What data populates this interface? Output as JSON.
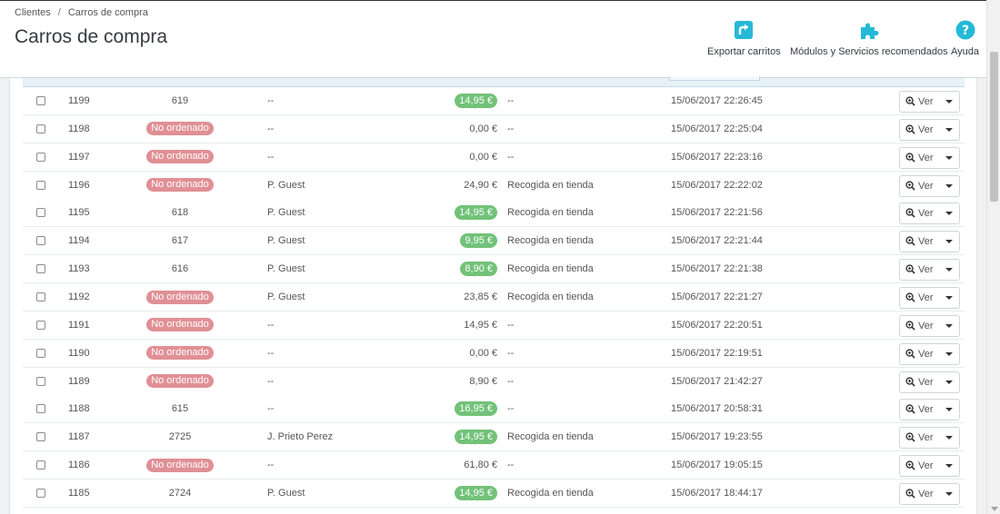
{
  "breadcrumb": {
    "parent": "Clientes",
    "separator": "/",
    "current": "Carros de compra"
  },
  "page_title": "Carros de compra",
  "toolbar": {
    "export_label": "Exportar carritos",
    "modules_label": "Módulos y Servicios recomendados",
    "help_label": "Ayuda"
  },
  "colors": {
    "accent": "#25b9d7",
    "badge_green": "#72c279",
    "badge_red": "#e08f95",
    "filter_row": "#e7f1f8"
  },
  "view_button_label": "Ver",
  "rows": [
    {
      "id": "1199",
      "order": "619",
      "order_status": "ordered",
      "customer": "--",
      "total": "14,95 €",
      "total_highlight": true,
      "carrier": "--",
      "date": "15/06/2017 22:26:45"
    },
    {
      "id": "1198",
      "order": "No ordenado",
      "order_status": "not_ordered",
      "customer": "--",
      "total": "0,00 €",
      "total_highlight": false,
      "carrier": "--",
      "date": "15/06/2017 22:25:04"
    },
    {
      "id": "1197",
      "order": "No ordenado",
      "order_status": "not_ordered",
      "customer": "--",
      "total": "0,00 €",
      "total_highlight": false,
      "carrier": "--",
      "date": "15/06/2017 22:23:16"
    },
    {
      "id": "1196",
      "order": "No ordenado",
      "order_status": "not_ordered",
      "customer": "P. Guest",
      "total": "24,90 €",
      "total_highlight": false,
      "carrier": "Recogida en tienda",
      "date": "15/06/2017 22:22:02"
    },
    {
      "id": "1195",
      "order": "618",
      "order_status": "ordered",
      "customer": "P. Guest",
      "total": "14,95 €",
      "total_highlight": true,
      "carrier": "Recogida en tienda",
      "date": "15/06/2017 22:21:56"
    },
    {
      "id": "1194",
      "order": "617",
      "order_status": "ordered",
      "customer": "P. Guest",
      "total": "9,95 €",
      "total_highlight": true,
      "carrier": "Recogida en tienda",
      "date": "15/06/2017 22:21:44"
    },
    {
      "id": "1193",
      "order": "616",
      "order_status": "ordered",
      "customer": "P. Guest",
      "total": "8,90 €",
      "total_highlight": true,
      "carrier": "Recogida en tienda",
      "date": "15/06/2017 22:21:38"
    },
    {
      "id": "1192",
      "order": "No ordenado",
      "order_status": "not_ordered",
      "customer": "P. Guest",
      "total": "23,85 €",
      "total_highlight": false,
      "carrier": "Recogida en tienda",
      "date": "15/06/2017 22:21:27"
    },
    {
      "id": "1191",
      "order": "No ordenado",
      "order_status": "not_ordered",
      "customer": "--",
      "total": "14,95 €",
      "total_highlight": false,
      "carrier": "--",
      "date": "15/06/2017 22:20:51"
    },
    {
      "id": "1190",
      "order": "No ordenado",
      "order_status": "not_ordered",
      "customer": "--",
      "total": "0,00 €",
      "total_highlight": false,
      "carrier": "--",
      "date": "15/06/2017 22:19:51"
    },
    {
      "id": "1189",
      "order": "No ordenado",
      "order_status": "not_ordered",
      "customer": "--",
      "total": "8,90 €",
      "total_highlight": false,
      "carrier": "--",
      "date": "15/06/2017 21:42:27"
    },
    {
      "id": "1188",
      "order": "615",
      "order_status": "ordered",
      "customer": "--",
      "total": "16,95 €",
      "total_highlight": true,
      "carrier": "--",
      "date": "15/06/2017 20:58:31"
    },
    {
      "id": "1187",
      "order": "2725",
      "order_status": "ordered",
      "customer": "J. Prieto Perez",
      "total": "14,95 €",
      "total_highlight": true,
      "carrier": "Recogida en tienda",
      "date": "15/06/2017 19:23:55"
    },
    {
      "id": "1186",
      "order": "No ordenado",
      "order_status": "not_ordered",
      "customer": "--",
      "total": "61,80 €",
      "total_highlight": false,
      "carrier": "--",
      "date": "15/06/2017 19:05:15"
    },
    {
      "id": "1185",
      "order": "2724",
      "order_status": "ordered",
      "customer": "P. Guest",
      "total": "14,95 €",
      "total_highlight": true,
      "carrier": "Recogida en tienda",
      "date": "15/06/2017 18:44:17"
    }
  ]
}
